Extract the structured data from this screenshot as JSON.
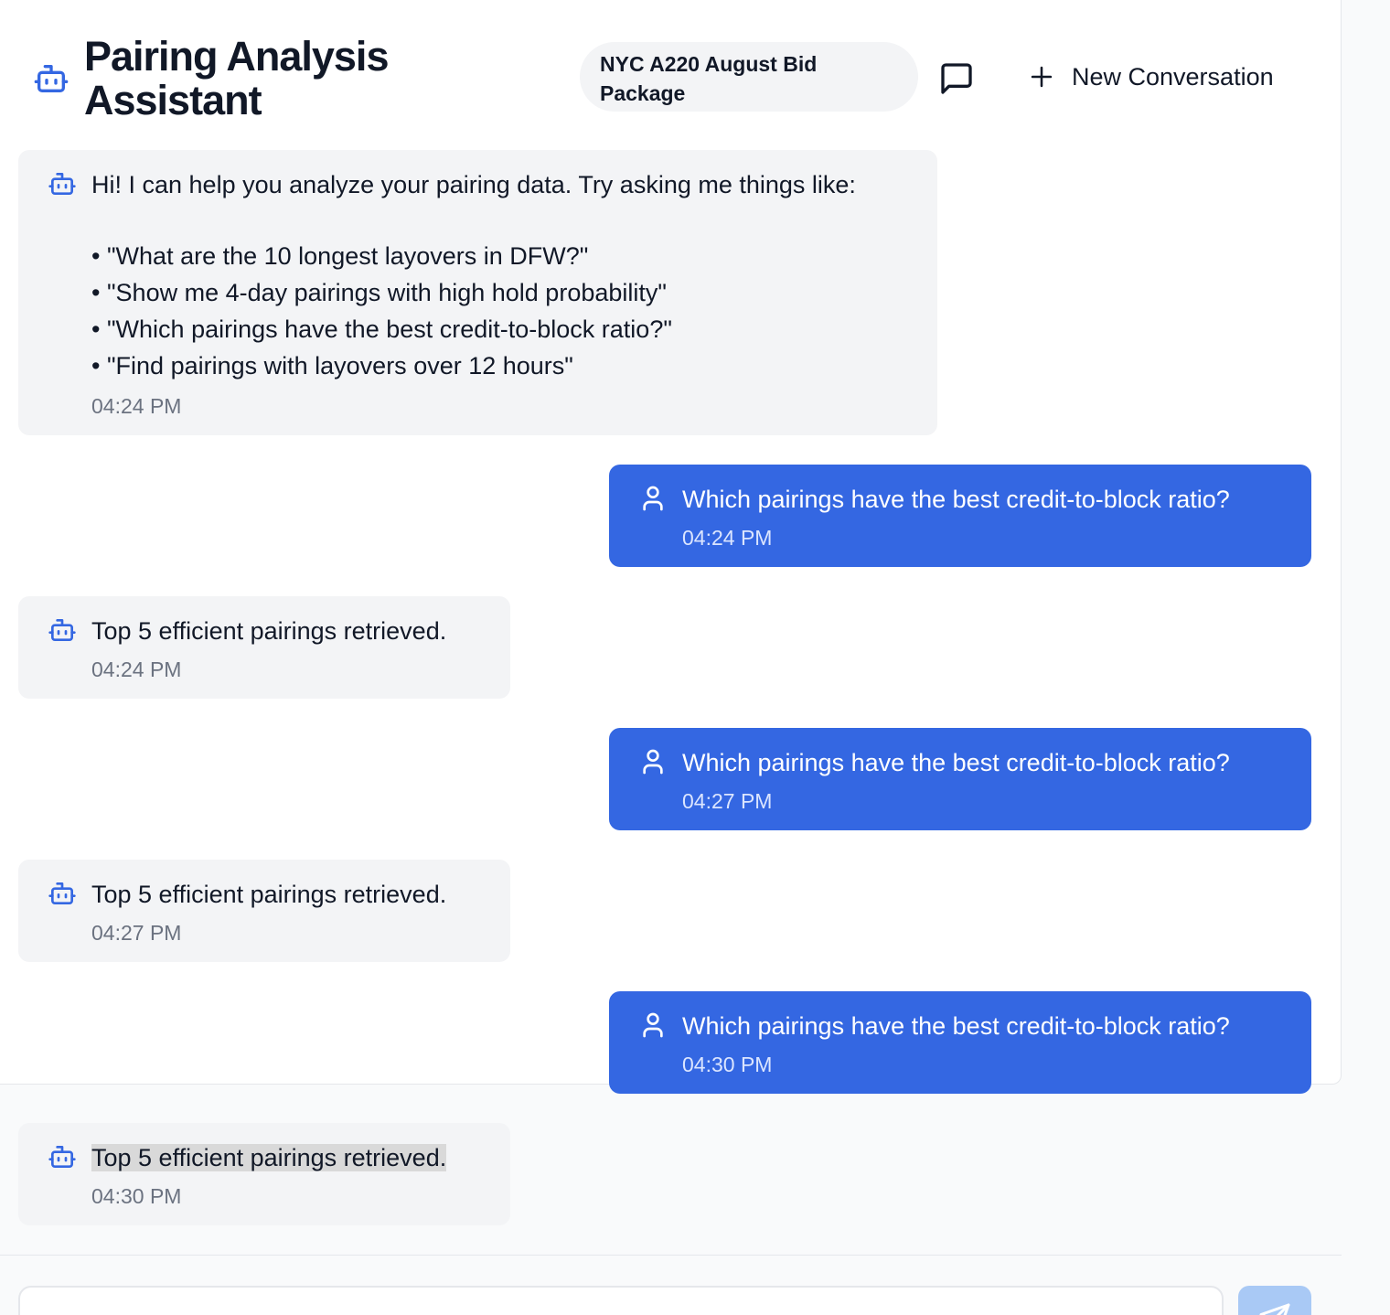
{
  "header": {
    "title": "Pairing Analysis Assistant",
    "package": "NYC A220 August Bid Package",
    "new_conversation_label": "New Conversation",
    "icons": {
      "assistant": "robot-icon",
      "chat": "message-square-icon",
      "new": "plus-icon"
    }
  },
  "colors": {
    "accent": "#3467e2",
    "bot_bubble": "#f3f4f6",
    "send_disabled": "#a9c9f5"
  },
  "messages": [
    {
      "role": "assistant",
      "text": "Hi! I can help you analyze your pairing data. Try asking me things like:",
      "bullets": [
        "\"What are the 10 longest layovers in DFW?\"",
        "\"Show me 4-day pairings with high hold probability\"",
        "\"Which pairings have the best credit-to-block ratio?\"",
        "\"Find pairings with layovers over 12 hours\""
      ],
      "time": "04:24 PM"
    },
    {
      "role": "user",
      "text": "Which pairings have the best credit-to-block ratio?",
      "time": "04:24 PM"
    },
    {
      "role": "assistant",
      "text": "Top 5 efficient pairings retrieved.",
      "time": "04:24 PM"
    },
    {
      "role": "user",
      "text": "Which pairings have the best credit-to-block ratio?",
      "time": "04:27 PM"
    },
    {
      "role": "assistant",
      "text": "Top 5 efficient pairings retrieved.",
      "time": "04:27 PM"
    },
    {
      "role": "user",
      "text": "Which pairings have the best credit-to-block ratio?",
      "time": "04:30 PM"
    },
    {
      "role": "assistant",
      "text": "Top 5 efficient pairings retrieved.",
      "time": "04:30 PM"
    }
  ],
  "composer": {
    "send_icon": "send-icon"
  }
}
